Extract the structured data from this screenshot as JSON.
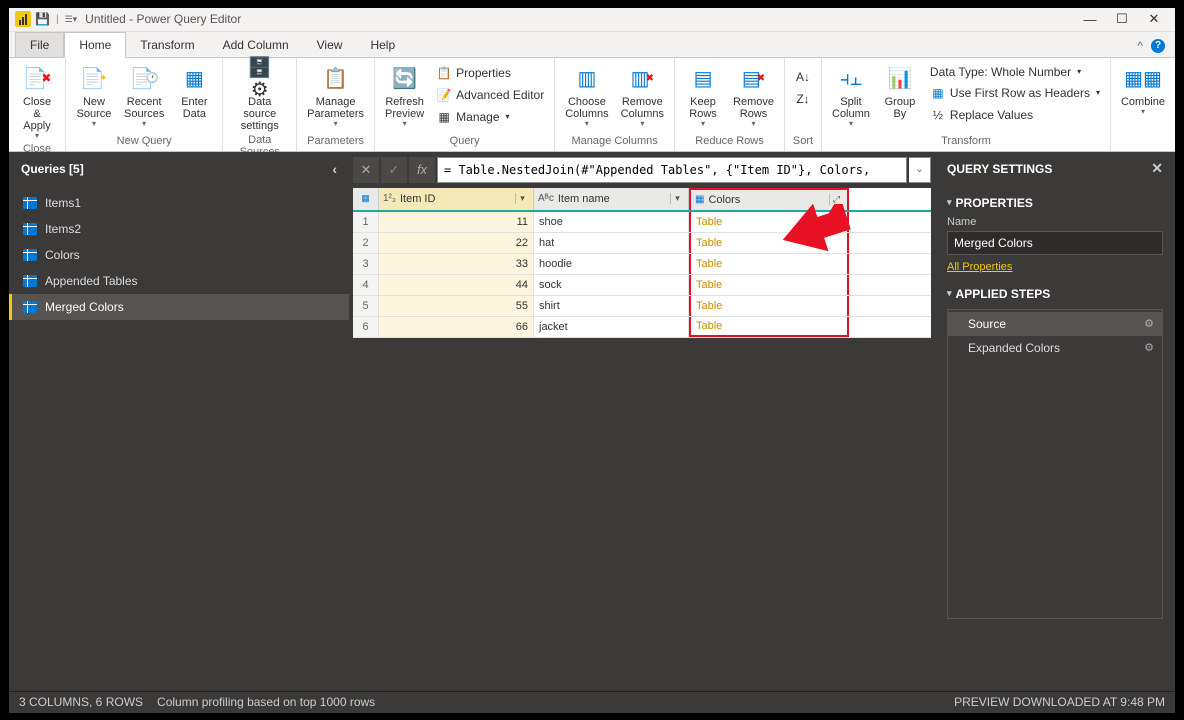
{
  "title": "Untitled - Power Query Editor",
  "tabs": {
    "file": "File",
    "home": "Home",
    "transform": "Transform",
    "addcol": "Add Column",
    "view": "View",
    "help": "Help"
  },
  "ribbon": {
    "close": {
      "label": "Close &\nApply",
      "group": "Close"
    },
    "newq": {
      "new": "New\nSource",
      "recent": "Recent\nSources",
      "enter": "Enter\nData",
      "group": "New Query"
    },
    "ds": {
      "label": "Data source\nsettings",
      "group": "Data Sources"
    },
    "params": {
      "label": "Manage\nParameters",
      "group": "Parameters"
    },
    "query": {
      "refresh": "Refresh\nPreview",
      "props": "Properties",
      "adv": "Advanced Editor",
      "manage": "Manage",
      "group": "Query"
    },
    "cols": {
      "choose": "Choose\nColumns",
      "remove": "Remove\nColumns",
      "group": "Manage Columns"
    },
    "rows": {
      "keep": "Keep\nRows",
      "remove": "Remove\nRows",
      "group": "Reduce Rows"
    },
    "sort": {
      "group": "Sort"
    },
    "split": {
      "label": "Split\nColumn"
    },
    "group": {
      "label": "Group\nBy"
    },
    "transform": {
      "dtype": "Data Type: Whole Number",
      "firstrow": "Use First Row as Headers",
      "replace": "Replace Values",
      "group": "Transform"
    },
    "combine": {
      "label": "Combine"
    }
  },
  "queries": {
    "title": "Queries [5]",
    "items": [
      "Items1",
      "Items2",
      "Colors",
      "Appended Tables",
      "Merged Colors"
    ],
    "selected": 4
  },
  "formula": "= Table.NestedJoin(#\"Appended Tables\", {\"Item ID\"}, Colors,",
  "grid": {
    "cols": [
      "Item ID",
      "Item name",
      "Colors"
    ],
    "rows": [
      {
        "n": 1,
        "id": 11,
        "name": "shoe",
        "c": "Table"
      },
      {
        "n": 2,
        "id": 22,
        "name": "hat",
        "c": "Table"
      },
      {
        "n": 3,
        "id": 33,
        "name": "hoodie",
        "c": "Table"
      },
      {
        "n": 4,
        "id": 44,
        "name": "sock",
        "c": "Table"
      },
      {
        "n": 5,
        "id": 55,
        "name": "shirt",
        "c": "Table"
      },
      {
        "n": 6,
        "id": 66,
        "name": "jacket",
        "c": "Table"
      }
    ]
  },
  "settings": {
    "title": "QUERY SETTINGS",
    "props": "PROPERTIES",
    "nameLabel": "Name",
    "name": "Merged Colors",
    "allProps": "All Properties",
    "steps": "APPLIED STEPS",
    "stepList": [
      "Source",
      "Expanded Colors"
    ],
    "stepSel": 0
  },
  "status": {
    "left": "3 COLUMNS, 6 ROWS",
    "mid": "Column profiling based on top 1000 rows",
    "right": "PREVIEW DOWNLOADED AT 9:48 PM"
  }
}
